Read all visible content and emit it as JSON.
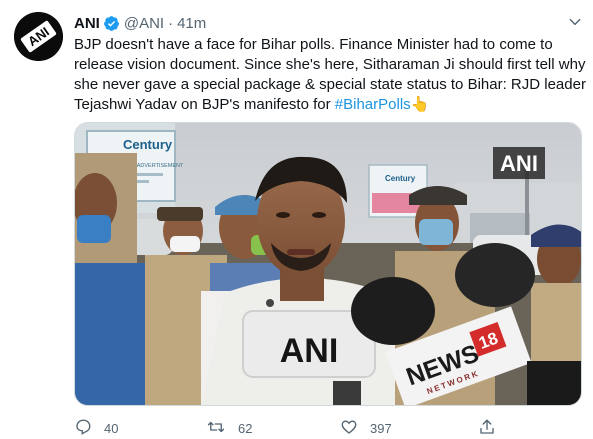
{
  "tweet": {
    "author_name": "ANI",
    "handle": "@ANI",
    "separator": "·",
    "time": "41m",
    "lines": [
      "BJP doesn't have a face for Bihar polls. Finance Minister had to come to",
      "release vision document. Since she's here, Sitharaman Ji should first tell why",
      "she never gave a special package & special state status to Bihar: RJD leader",
      "Tejashwi Yadav on BJP's manifesto for "
    ],
    "hashtag": "#BiharPolls",
    "emoji": "👆",
    "avatar_logo_text": "ANI",
    "media": {
      "watermark": "ANI",
      "mic1_text": "ANI",
      "mic2_brand": "NEWS",
      "mic2_number": "18",
      "mic2_sub": "NETWORK",
      "banner1_title": "Century",
      "banner1_sub": "Now book site for ADVERTISEMENT",
      "banner2_title": "Century"
    },
    "actions": {
      "reply_count": "40",
      "retweet_count": "62",
      "like_count": "397"
    }
  },
  "colors": {
    "link": "#1b95e0",
    "verified": "#1d9bf0",
    "muted": "#536471",
    "text": "#0f1419"
  },
  "icons": [
    "ani-logo",
    "verified-badge-icon",
    "chevron-down-icon",
    "reply-icon",
    "retweet-icon",
    "like-icon",
    "share-icon"
  ]
}
